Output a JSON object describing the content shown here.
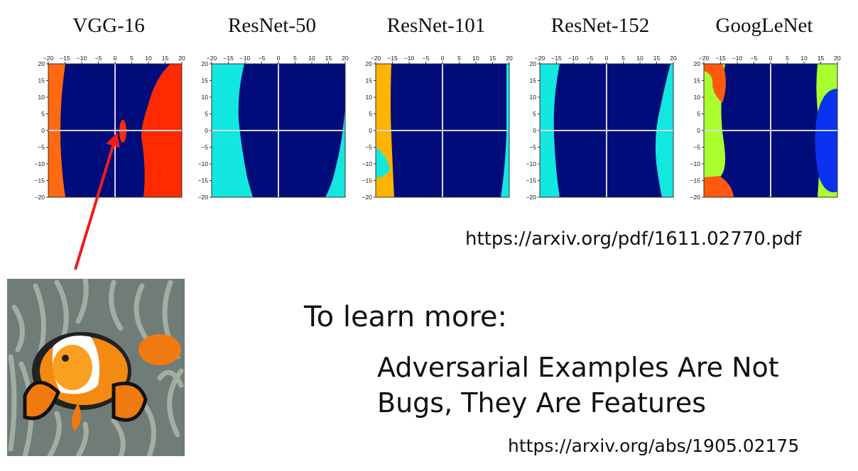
{
  "chart_data": [
    {
      "type": "heatmap",
      "title": "VGG-16",
      "x_ticks": [
        "−20",
        "−15",
        "−10",
        "−5",
        "0",
        "5",
        "10",
        "15",
        "20"
      ],
      "y_ticks": [
        "20",
        "15",
        "10",
        "5",
        "0",
        "−5",
        "−10",
        "−15",
        "−20"
      ],
      "xlim": [
        -20,
        20
      ],
      "ylim": [
        -20,
        20
      ],
      "regions": [
        {
          "color": "#000c7a",
          "role": "background"
        },
        {
          "color": "#ff6a10"
        },
        {
          "color": "#ff2a00"
        }
      ]
    },
    {
      "type": "heatmap",
      "title": "ResNet-50",
      "x_ticks": [
        "−20",
        "−15",
        "−10",
        "−5",
        "0",
        "5",
        "10",
        "15",
        "20"
      ],
      "y_ticks": [
        "20",
        "15",
        "10",
        "5",
        "0",
        "−5",
        "−10",
        "−15",
        "−20"
      ],
      "xlim": [
        -20,
        20
      ],
      "ylim": [
        -20,
        20
      ],
      "regions": [
        {
          "color": "#000c7a",
          "role": "background"
        },
        {
          "color": "#12e8e0"
        }
      ]
    },
    {
      "type": "heatmap",
      "title": "ResNet-101",
      "x_ticks": [
        "−20",
        "−15",
        "−10",
        "−5",
        "0",
        "5",
        "10",
        "15",
        "20"
      ],
      "y_ticks": [
        "20",
        "15",
        "10",
        "5",
        "0",
        "−5",
        "−10",
        "−15",
        "−20"
      ],
      "xlim": [
        -20,
        20
      ],
      "ylim": [
        -20,
        20
      ],
      "regions": [
        {
          "color": "#000c7a",
          "role": "background"
        },
        {
          "color": "#ffb400"
        },
        {
          "color": "#12e8e0"
        }
      ]
    },
    {
      "type": "heatmap",
      "title": "ResNet-152",
      "x_ticks": [
        "−20",
        "−15",
        "−10",
        "−5",
        "0",
        "5",
        "10",
        "15",
        "20"
      ],
      "y_ticks": [
        "20",
        "15",
        "10",
        "5",
        "0",
        "−5",
        "−10",
        "−15",
        "−20"
      ],
      "xlim": [
        -20,
        20
      ],
      "ylim": [
        -20,
        20
      ],
      "regions": [
        {
          "color": "#000c7a",
          "role": "background"
        },
        {
          "color": "#12e8e0"
        }
      ]
    },
    {
      "type": "heatmap",
      "title": "GoogLeNet",
      "x_ticks": [
        "−20",
        "−15",
        "−10",
        "−5",
        "0",
        "5",
        "10",
        "15",
        "20"
      ],
      "y_ticks": [
        "20",
        "15",
        "10",
        "5",
        "0",
        "−5",
        "−10",
        "−15",
        "−20"
      ],
      "xlim": [
        -20,
        20
      ],
      "ylim": [
        -20,
        20
      ],
      "regions": [
        {
          "color": "#000c7a",
          "role": "background"
        },
        {
          "color": "#aaff30"
        },
        {
          "color": "#ff5a10"
        },
        {
          "color": "#0a32f0"
        }
      ]
    }
  ],
  "slide": {
    "paper_url_1": "https://arxiv.org/pdf/1611.02770.pdf",
    "learn_more": "To learn more:",
    "paper_title_line1": "Adversarial Examples Are Not",
    "paper_title_line2": "Bugs, They Are Features",
    "paper_url_2": "https://arxiv.org/abs/1905.02175"
  },
  "colors": {
    "arrow": "#ee1c1c",
    "crosshair": "#d8d8e8"
  }
}
